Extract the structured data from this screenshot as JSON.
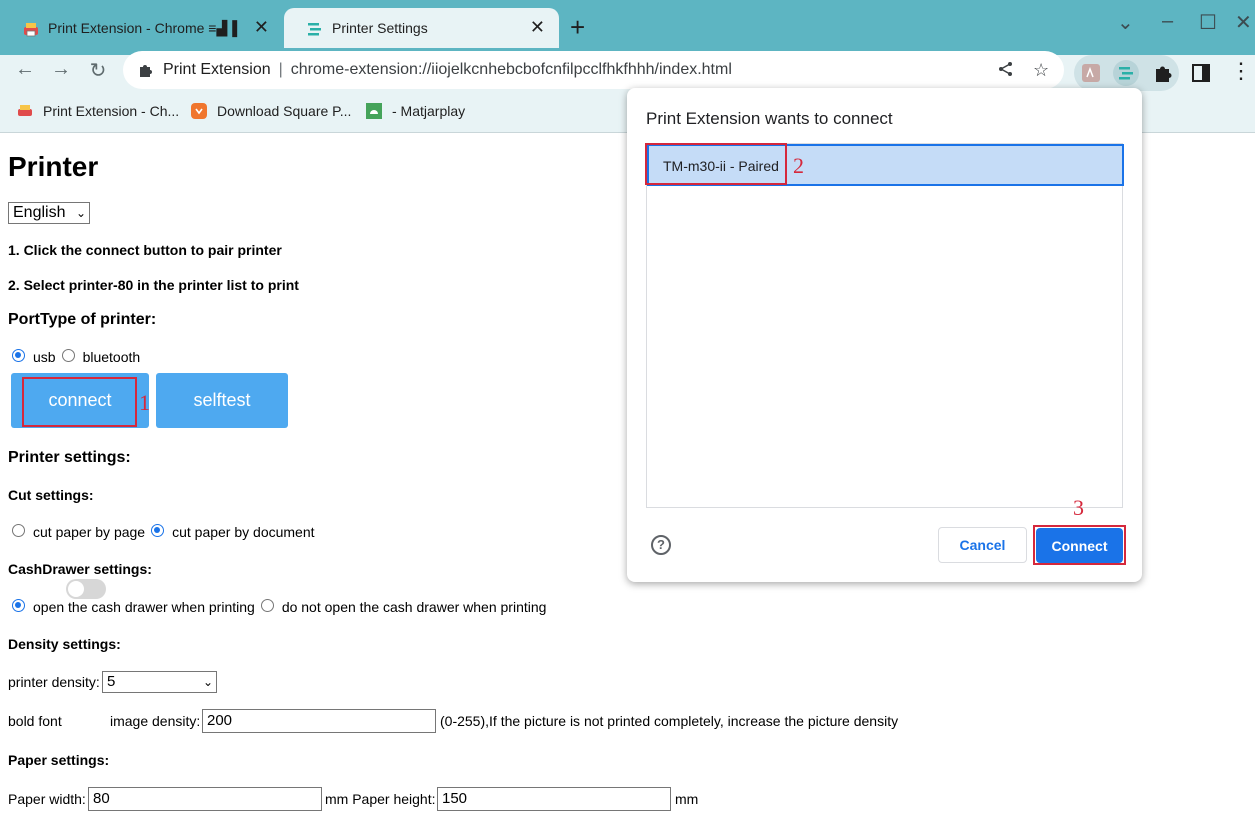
{
  "tabs": [
    {
      "title": "Print Extension - Chrome ≡▟▐",
      "active": false
    },
    {
      "title": "Printer Settings",
      "active": true
    }
  ],
  "window_controls": [
    "chevron-down",
    "minimize",
    "maximize",
    "close"
  ],
  "omnibox": {
    "site": "Print Extension",
    "separator": "|",
    "url": "chrome-extension://iiojelkcnhebcbofcnfilpcclfhkfhhh/index.html"
  },
  "bookmarks": [
    {
      "label": "Print Extension - Ch..."
    },
    {
      "label": "Download Square P..."
    },
    {
      "label": "- Matjarplay"
    }
  ],
  "page": {
    "title": "Printer",
    "language": "English",
    "step1": "1. Click the connect button to pair printer",
    "step2": "2. Select printer-80 in the printer list to print",
    "port_heading": "PortType of printer:",
    "port_options": [
      {
        "label": "usb",
        "checked": true
      },
      {
        "label": "bluetooth",
        "checked": false
      }
    ],
    "connect_label": "connect",
    "selftest_label": "selftest",
    "printer_settings_heading": "Printer settings:",
    "cut_heading": "Cut settings:",
    "cut_options": [
      {
        "label": "cut paper by page",
        "checked": false
      },
      {
        "label": "cut paper by document",
        "checked": true
      }
    ],
    "cash_heading": "CashDrawer settings:",
    "cash_options": [
      {
        "label": "open the cash drawer when printing",
        "checked": true
      },
      {
        "label": "do not open the cash drawer when printing",
        "checked": false
      }
    ],
    "density_heading": "Density settings:",
    "density_label": "printer density:",
    "density_value": "5",
    "bold_font_label": "bold font",
    "bold_font_on": false,
    "image_density_label": "image density:",
    "image_density_value": "200",
    "image_density_hint": "(0-255),If the picture is not printed completely, increase the picture density",
    "paper_heading": "Paper settings:",
    "paper_width_label": "Paper width:",
    "paper_width_value": "80",
    "paper_height_label": "mm Paper height:",
    "paper_height_value": "150",
    "paper_unit": "mm"
  },
  "dialog": {
    "title": "Print Extension wants to connect",
    "device": "TM-m30-ii - Paired",
    "cancel_label": "Cancel",
    "connect_label": "Connect",
    "help_glyph": "?"
  },
  "annotations": [
    "1",
    "2",
    "3"
  ],
  "colors": {
    "tabstrip": "#5db5c2",
    "toolbar": "#e8f3f5",
    "page_button": "#4ea9f0",
    "primary": "#1a73e8",
    "annotation": "#d5283c"
  }
}
